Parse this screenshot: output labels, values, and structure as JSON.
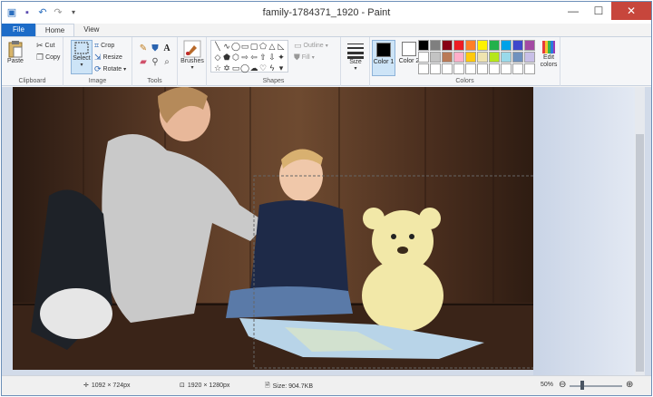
{
  "window": {
    "title": "family-1784371_1920 - Paint",
    "controls": {
      "minimize": "—",
      "maximize": "☐",
      "close": "✕"
    }
  },
  "quick_access": [
    "paint-app-icon",
    "save-icon",
    "undo-icon",
    "redo-icon",
    "customize-icon"
  ],
  "tabs": [
    {
      "label": "File"
    },
    {
      "label": "Home"
    },
    {
      "label": "View"
    }
  ],
  "ribbon": {
    "clipboard": {
      "label": "Clipboard",
      "paste": "Paste",
      "cut": "Cut",
      "copy": "Copy"
    },
    "image": {
      "label": "Image",
      "select": "Select",
      "crop": "Crop",
      "resize": "Resize",
      "rotate": "Rotate"
    },
    "tools": {
      "label": "Tools"
    },
    "brushes": {
      "label": "Brushes"
    },
    "shapes": {
      "label": "Shapes",
      "outline": "Outline",
      "fill": "Fill"
    },
    "size": {
      "label": "Size"
    },
    "colors": {
      "label": "Colors",
      "color1": "Color 1",
      "color2": "Color 2",
      "edit": "Edit colors",
      "color1_value": "#000000",
      "color2_value": "#ffffff",
      "palette": [
        "#000000",
        "#7f7f7f",
        "#880015",
        "#ed1c24",
        "#ff7f27",
        "#fff200",
        "#22b14c",
        "#00a2e8",
        "#3f48cc",
        "#a349a4",
        "#ffffff",
        "#c3c3c3",
        "#b97a57",
        "#ffaec9",
        "#ffc90e",
        "#efe4b0",
        "#b5e61d",
        "#99d9ea",
        "#7092be",
        "#c8bfe7",
        "#ffffff",
        "#ffffff",
        "#ffffff",
        "#ffffff",
        "#ffffff",
        "#ffffff",
        "#ffffff",
        "#ffffff",
        "#ffffff",
        "#ffffff"
      ]
    }
  },
  "status": {
    "cursor_pos": "1092 × 724px",
    "image_size": "1920 × 1280px",
    "file_size": "Size: 904.7KB",
    "zoom": "50%"
  }
}
